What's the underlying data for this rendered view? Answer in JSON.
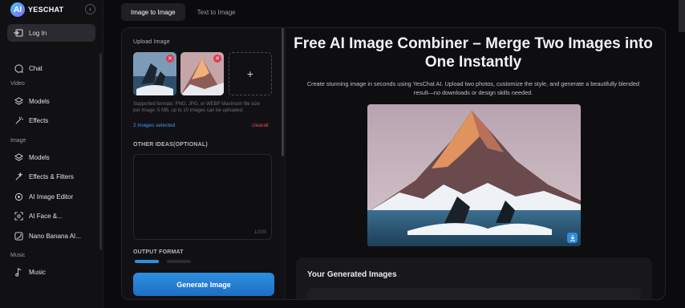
{
  "sidebar": {
    "brand": "YESCHAT",
    "login_label": "Log In",
    "items": [
      {
        "label": "Chat"
      },
      {
        "section": "Video"
      },
      {
        "label": "Models"
      },
      {
        "label": "Effects"
      },
      {
        "section": "Image"
      },
      {
        "label": "Models"
      },
      {
        "label": "Effects & Filters"
      },
      {
        "label": "AI Image Editor"
      },
      {
        "label": "AI Face &..."
      },
      {
        "label": "Nano Banana AI..."
      },
      {
        "section": "Music"
      },
      {
        "label": "Music"
      }
    ]
  },
  "tabs": [
    {
      "label": "Image to Image",
      "active": true
    },
    {
      "label": "Text to Image",
      "active": false
    }
  ],
  "upload": {
    "label": "Upload Image",
    "add_symbol": "+",
    "hint": "Supported formats: PNG, JPG, or WEBP Maximum file size per image: 5 MB, up to 10 images can be uploaded.",
    "selected_text": "2 images selected",
    "clear_label": "clearall"
  },
  "ideas": {
    "label": "OTHER IDEAS(OPTIONAL)",
    "counter": "1/200"
  },
  "output_format_label": "OUTPUT FORMAT",
  "generate_label": "Generate Image",
  "hero": {
    "title": "Free AI Image Combiner – Merge Two Images into One Instantly",
    "subtitle": "Create stunning image in seconds using YesChat AI. Upload two photos, customize the style, and generate a beautifully blended result—no downloads or design skills needed."
  },
  "results_title": "Your Generated Images",
  "colors": {
    "accent": "#2e8fe0",
    "danger": "#e24a52",
    "link": "#3f97f0"
  }
}
